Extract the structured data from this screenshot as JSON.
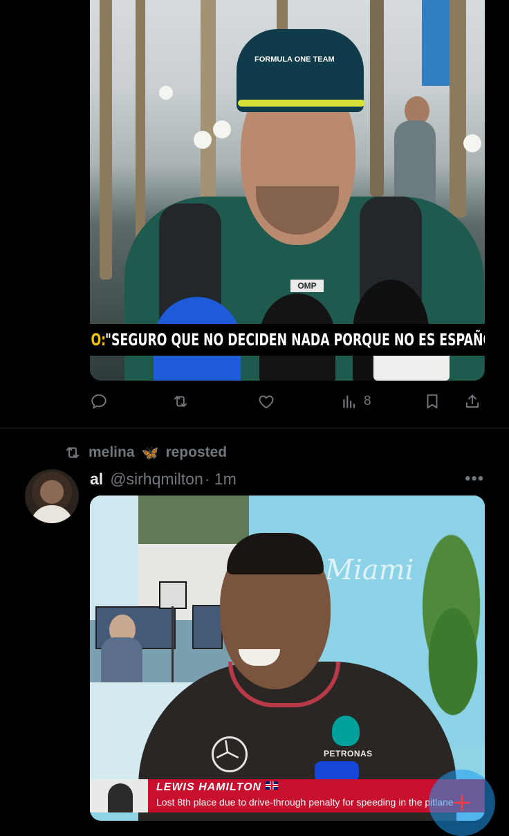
{
  "post1": {
    "caption_accent": "O:",
    "caption_text": "\"SEGURO QUE NO DECIDEN NADA PORQUE NO ES ESPAÑOL\"",
    "cap_text": "FORMULA ONE TEAM",
    "shirt_logo": "OMP",
    "actions": {
      "views_count": "8"
    }
  },
  "post2": {
    "repost_user": "melina",
    "repost_emoji": "🦋",
    "repost_label": "reposted",
    "author_name": "al",
    "author_handle": "@sirhqmilton",
    "time": "· 1m",
    "more_label": "•••",
    "media": {
      "lower_third_name": "LEWIS HAMILTON",
      "lower_third_sub": "Lost 8th place due to drive-through penalty for speeding in the pitlane",
      "sponsor_text": "PETRONAS",
      "backdrop_script": "Miami"
    }
  },
  "colors": {
    "background": "#000000",
    "muted": "#71767b",
    "accent": "#1d9bf0",
    "lower_third_red": "#c8102e",
    "caption_yellow": "#f2c200"
  },
  "icons": [
    "reply-icon",
    "repost-icon",
    "like-icon",
    "views-icon",
    "bookmark-icon",
    "share-icon",
    "more-icon",
    "compose-icon"
  ]
}
